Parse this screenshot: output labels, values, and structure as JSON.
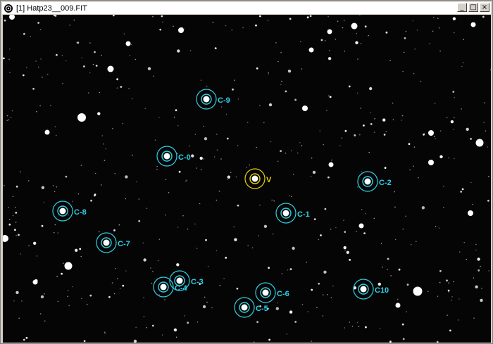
{
  "window": {
    "title": "[1] Hatp23__009.FIT",
    "controls": [
      "minimize",
      "maximize",
      "close"
    ],
    "minimize_glyph": "_",
    "maximize_glyph": "□",
    "close_glyph": "×"
  },
  "colors": {
    "comparison": "#2fd0e6",
    "variable": "#e8d400",
    "sky": "#050505",
    "star": "#ffffff"
  },
  "apertures": [
    {
      "label": "C-0",
      "kind": "comparison"
    },
    {
      "label": "C-1",
      "kind": "comparison"
    },
    {
      "label": "C-2",
      "kind": "comparison"
    },
    {
      "label": "C-3",
      "kind": "comparison"
    },
    {
      "label": "C-4",
      "kind": "comparison"
    },
    {
      "label": "C-5",
      "kind": "comparison"
    },
    {
      "label": "C-6",
      "kind": "comparison"
    },
    {
      "label": "C-7",
      "kind": "comparison"
    },
    {
      "label": "C-8",
      "kind": "comparison"
    },
    {
      "label": "C-9",
      "kind": "comparison"
    },
    {
      "label": "C10",
      "kind": "comparison"
    },
    {
      "label": "V",
      "kind": "variable"
    }
  ]
}
